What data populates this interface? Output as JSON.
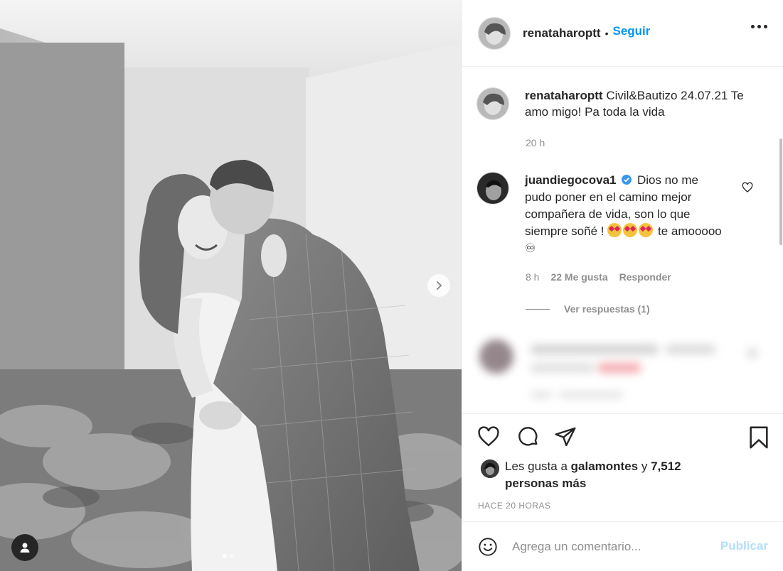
{
  "post": {
    "username": "renatahar​optt",
    "follow_label": "Seguir",
    "separator": "•"
  },
  "caption": {
    "username": "renataharoptt",
    "text": "Civil&Bautizo 24.07.21 Te amo migo! Pa toda la vida",
    "time": "20 h"
  },
  "comment": {
    "username": "juandiegocova1",
    "text_before": "Dios no me pudo poner en el camino mejor compañera de vida, son lo que siempre soñé !",
    "text_after": "te amooooo ♾",
    "time": "8 h",
    "likes": "22 Me gusta",
    "reply_label": "Responder",
    "view_replies": "Ver respuestas (1)"
  },
  "likes": {
    "prefix": "Les gusta a",
    "user": "galamontes",
    "joiner": "y",
    "others": "7,512 personas más"
  },
  "timestamp": "HACE 20 HORAS",
  "comment_input": {
    "placeholder": "Agrega un comentario...",
    "publish_label": "Publicar"
  },
  "colors": {
    "accent": "#0095f6",
    "publish_disabled": "#b2dffc",
    "text_secondary": "#8e8e8e",
    "verified": "#3897f0"
  },
  "icons": [
    "heart-icon",
    "comment-icon",
    "share-icon",
    "bookmark-icon",
    "more-icon",
    "chevron-right-icon",
    "user-tag-icon",
    "emoji-icon",
    "verified-icon"
  ]
}
